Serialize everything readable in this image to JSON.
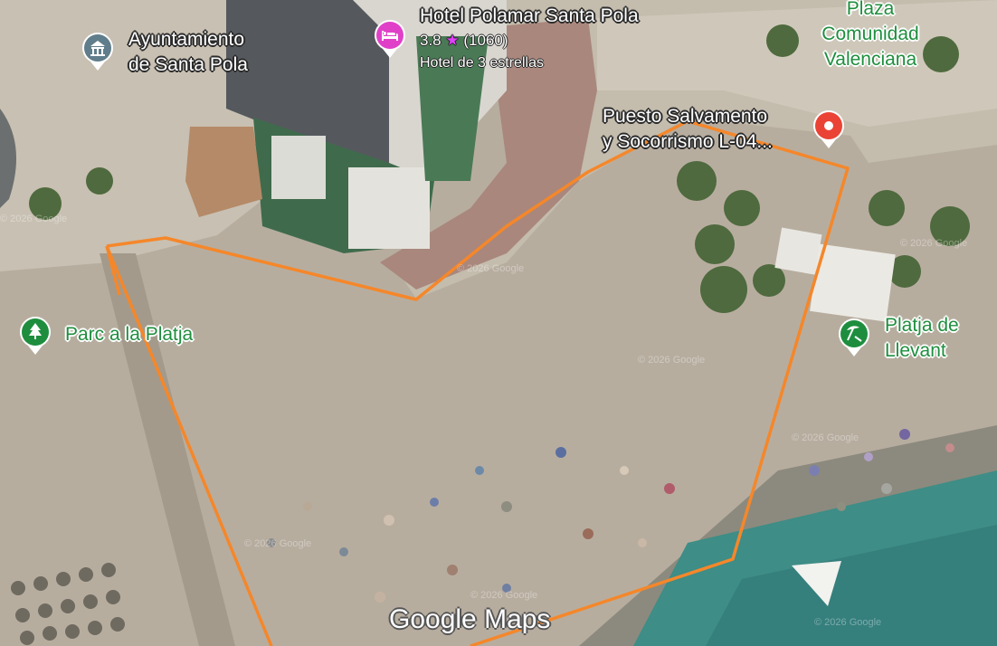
{
  "places": {
    "ayuntamiento": {
      "line1": "Ayuntamiento",
      "line2": "de Santa Pola",
      "icon": "town-hall-icon",
      "color": "#607d8b"
    },
    "hotel": {
      "name": "Hotel Polamar Santa Pola",
      "rating": "3.8",
      "star": "★",
      "reviews": "(1060)",
      "category": "Hotel de 3 estrellas",
      "icon": "hotel-bed-icon",
      "color": "#e040c8"
    },
    "plaza": {
      "line1": "Plaza",
      "line2": "Comunidad",
      "line3": "Valenciana"
    },
    "puesto": {
      "line1": "Puesto Salvamento",
      "line2": "y Socorrismo L-04...",
      "icon": "red-location-pin-icon",
      "color": "#ea4335"
    },
    "parc": {
      "name": "Parc a la Platja",
      "icon": "tree-park-icon",
      "color": "#1e8e3e"
    },
    "platja": {
      "line1": "Platja de",
      "line2": "Llevant",
      "icon": "beach-umbrella-icon",
      "color": "#1e8e3e"
    }
  },
  "watermark": "© 2026 Google",
  "logo": "Google Maps",
  "colors": {
    "boundary": "#f5872a",
    "sand": "#b9afa1",
    "sea": "#3e8d86",
    "park_label": "#1e8e3e"
  }
}
